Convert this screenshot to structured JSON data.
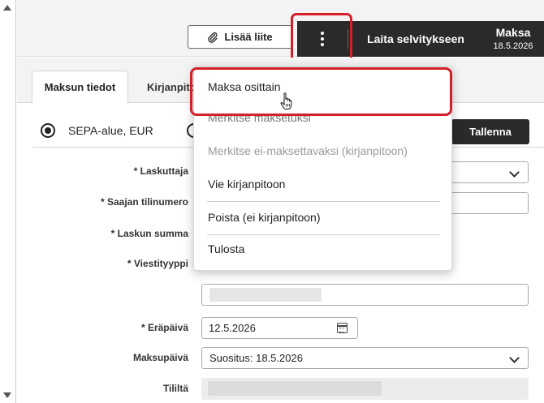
{
  "toolbar": {
    "attach_label": "Lisää liite",
    "more_icon": "vertical-ellipsis-icon",
    "send_to_review_label": "Laita selvitykseen",
    "pay_label": "Maksa",
    "pay_date": "18.5.2026"
  },
  "tabs": [
    {
      "label": "Maksun tiedot",
      "active": true
    },
    {
      "label": "Kirjanpito",
      "active": false
    }
  ],
  "payment_type": {
    "options": [
      {
        "label": "SEPA-alue, EUR",
        "checked": true
      },
      {
        "label": "",
        "checked": false
      }
    ],
    "save_label": "Tallenna"
  },
  "form": {
    "biller_label": "* Laskuttaja",
    "recipient_account_label": "* Saajan tilinumero",
    "invoice_amount_label": "* Laskun summa",
    "message_type_label": "* Viestityyppi",
    "due_date_label": "* Eräpäivä",
    "due_date_value": "12.5.2026",
    "payment_date_label": "Maksupäivä",
    "payment_date_value": "Suositus: 18.5.2026",
    "account_label": "Tililtä"
  },
  "menu": {
    "items": [
      {
        "label": "Maksa osittain",
        "enabled": true,
        "highlighted": true
      },
      {
        "label": "Merkitse maksetuksi",
        "enabled": true
      },
      {
        "label": "Merkitse ei-maksettavaksi (kirjanpitoon)",
        "enabled": false
      },
      {
        "label": "Vie kirjanpitoon",
        "enabled": true
      },
      {
        "label": "Poista (ei kirjanpitoon)",
        "enabled": true
      },
      {
        "label": "Tulosta",
        "enabled": true
      }
    ]
  },
  "colors": {
    "highlight": "#d5202b",
    "dark_button": "#2a2a2a"
  }
}
